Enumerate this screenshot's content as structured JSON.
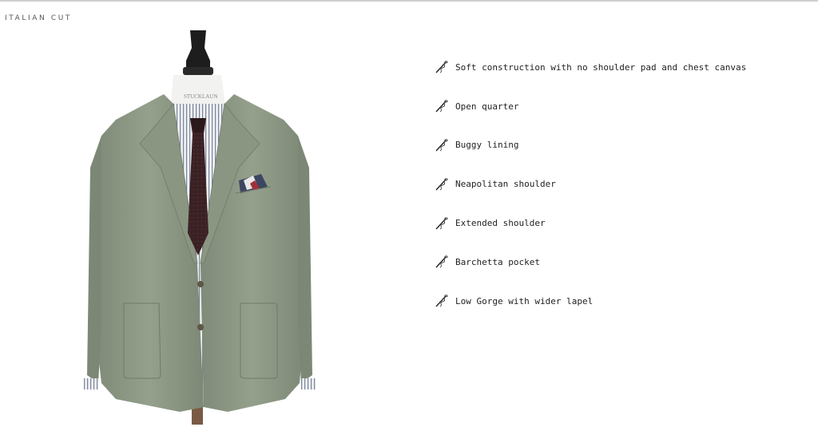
{
  "section": {
    "title": "ITALIAN CUT"
  },
  "image": {
    "collar_tag": "STUCKLAUN",
    "icon_name": "needle-thread-icon",
    "colors": {
      "jacket": "#8e9a86",
      "tie": "#3a2124",
      "shirt_stripe": "#6a7486"
    }
  },
  "features": [
    {
      "label": "Soft construction with no shoulder pad and chest canvas",
      "icon": "needle-thread-icon"
    },
    {
      "label": "Open quarter",
      "icon": "needle-thread-icon"
    },
    {
      "label": "Buggy lining",
      "icon": "needle-thread-icon"
    },
    {
      "label": "Neapolitan shoulder",
      "icon": "needle-thread-icon"
    },
    {
      "label": "Extended shoulder",
      "icon": "needle-thread-icon"
    },
    {
      "label": "Barchetta pocket",
      "icon": "needle-thread-icon"
    },
    {
      "label": "Low Gorge with wider lapel",
      "icon": "needle-thread-icon"
    }
  ]
}
